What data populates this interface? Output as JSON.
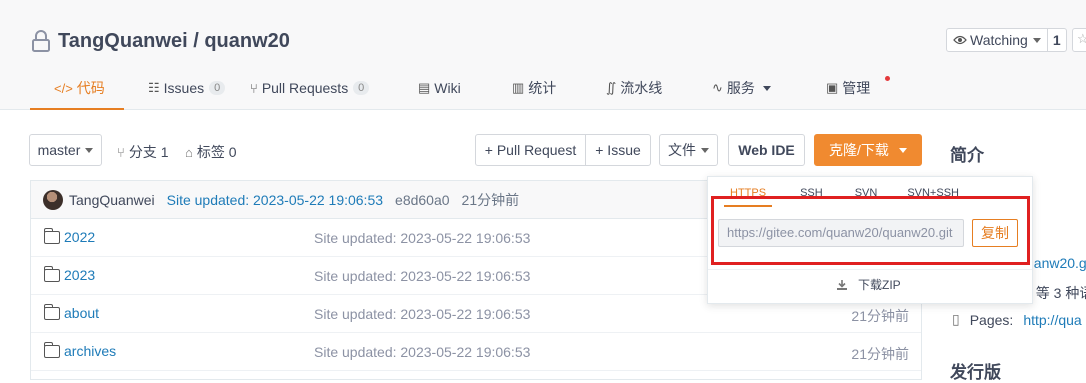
{
  "repo": {
    "owner": "TangQuanwei",
    "separator": " / ",
    "name": "quanw20"
  },
  "watch": {
    "label": "Watching",
    "count": "1"
  },
  "nav": [
    {
      "icon": "</>",
      "label": "代码",
      "active": true
    },
    {
      "icon": "☷",
      "label": "Issues",
      "badge": "0"
    },
    {
      "icon": "⑂",
      "label": "Pull Requests",
      "badge": "0"
    },
    {
      "icon": "▤",
      "label": "Wiki"
    },
    {
      "icon": "▥",
      "label": "统计"
    },
    {
      "icon": "∬",
      "label": "流水线"
    },
    {
      "icon": "∿",
      "label": "服务"
    },
    {
      "icon": "▣",
      "label": "管理"
    }
  ],
  "toolbar": {
    "branch": "master",
    "branches": "分支 1",
    "tags": "标签 0",
    "pull_request": "+ Pull Request",
    "issue": "+ Issue",
    "file": "文件",
    "web_ide": "Web IDE",
    "clone": "克隆/下载"
  },
  "commit": {
    "author": "TangQuanwei",
    "message": "Site updated: 2023-05-22 19:06:53",
    "hash": "e8d60a0",
    "time": "21分钟前"
  },
  "files": [
    {
      "name": "2022",
      "message": "Site updated: 2023-05-22 19:06:53",
      "time": ""
    },
    {
      "name": "2023",
      "message": "Site updated: 2023-05-22 19:06:53",
      "time": ""
    },
    {
      "name": "about",
      "message": "Site updated: 2023-05-22 19:06:53",
      "time": "21分钟前"
    },
    {
      "name": "archives",
      "message": "Site updated: 2023-05-22 19:06:53",
      "time": "21分钟前"
    }
  ],
  "sidebar": {
    "title": "简介",
    "url_fragment": "uanw20.g",
    "lang_fragment": "t 等 3 种语",
    "pages_label": "Pages:",
    "pages_link": "http://qua",
    "release_title": "发行版"
  },
  "clone_dropdown": {
    "tabs": [
      "HTTPS",
      "SSH",
      "SVN",
      "SVN+SSH"
    ],
    "url": "https://gitee.com/quanw20/quanw20.git",
    "copy": "复制",
    "zip": "下载ZIP"
  },
  "colors": {
    "accent": "#e67e22",
    "link": "#1e7bb8",
    "highlight": "#e02020"
  }
}
